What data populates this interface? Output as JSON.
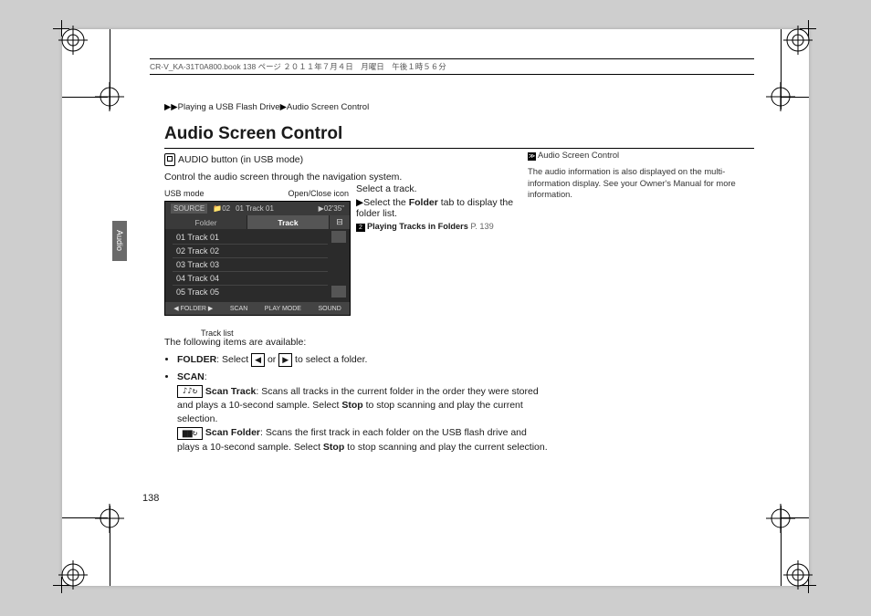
{
  "header": "CR-V_KA-31T0A800.book  138 ページ  ２０１１年７月４日　月曜日　午後１時５６分",
  "breadcrumb": {
    "a": "Playing a USB Flash Drive",
    "b": "Audio Screen Control"
  },
  "title": "Audio Screen Control",
  "entry_label": "AUDIO button (in USB mode)",
  "intro": "Control the audio screen through the navigation system.",
  "figure": {
    "label_left": "USB mode",
    "label_right": "Open/Close icon",
    "caption": "Track list",
    "bar": {
      "source": "SOURCE",
      "folder_ind": "02",
      "track_ind": "01 Track 01",
      "time": "02'35\""
    },
    "tabs": {
      "folder": "Folder",
      "track": "Track"
    },
    "tracks": [
      "01  Track 01",
      "02  Track 02",
      "03  Track 03",
      "04  Track 04",
      "05  Track 05"
    ],
    "bottom": [
      "◀   FOLDER   ▶",
      "SCAN",
      "PLAY MODE",
      "SOUND"
    ]
  },
  "side_tab": "Audio",
  "right": {
    "l1": "Select a track.",
    "l2a": "Select the ",
    "l2b": "Folder",
    "l2c": " tab to display the folder list.",
    "link_label": "Playing Tracks in Folders",
    "link_page": "P. 139"
  },
  "notes": {
    "heading": "Audio Screen Control",
    "p1": "The audio information is also displayed on the multi-information display. See your Owner's Manual for more information."
  },
  "body": {
    "avail": "The following items are available:",
    "folder_label": "FOLDER",
    "folder_text": ": Select ",
    "folder_or": " or ",
    "folder_rest": " to select a folder.",
    "scan_label": "SCAN",
    "scan_colon": ":",
    "scan_track_label": "Scan Track",
    "scan_track_text": ": Scans all tracks in the current folder in the order they were stored and plays a 10-second sample. Select ",
    "stop": "Stop",
    "scan_track_rest": " to stop scanning and play the current selection.",
    "scan_folder_label": "Scan Folder",
    "scan_folder_text": ": Scans the first track in each folder on the USB flash drive and plays a 10-second sample. Select ",
    "scan_folder_rest": " to stop scanning and play the current selection."
  },
  "page_number": "138"
}
